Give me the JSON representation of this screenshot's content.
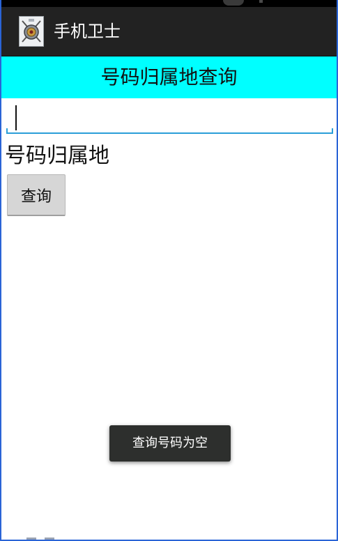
{
  "app": {
    "title": "手机卫士",
    "icon": "shield-logo-icon"
  },
  "banner": {
    "title": "号码归属地查询",
    "color": "#00ffff"
  },
  "phone_input": {
    "value": "",
    "placeholder": ""
  },
  "result": {
    "label": "号码归属地"
  },
  "actions": {
    "query_label": "查询"
  },
  "toast": {
    "message": "查询号码为空"
  },
  "colors": {
    "action_bar": "#222222",
    "accent_underline": "#2a9ed8",
    "button_bg": "#d6d6d6",
    "toast_bg": "#2d2f2d"
  }
}
